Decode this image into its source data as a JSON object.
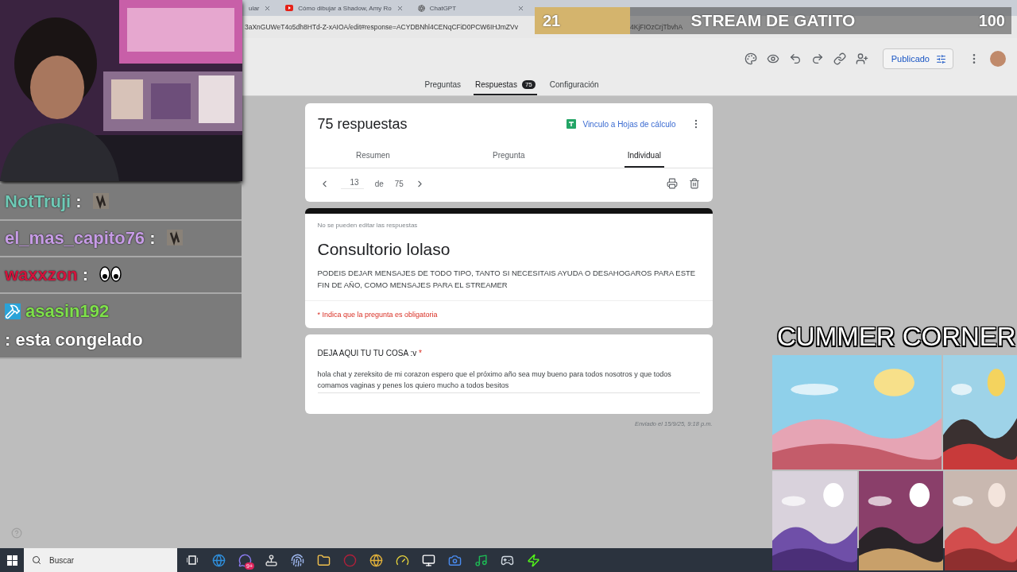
{
  "browser": {
    "tabs": [
      {
        "title": "ular",
        "kind": "plain"
      },
      {
        "title": "Cómo dibujar a Shadow, Amy Ro",
        "kind": "video"
      },
      {
        "title": "ChatGPT",
        "kind": "chat"
      }
    ],
    "address": [
      "3aXnGUWeT4o5dh8HTd-Z-xAIOA/edit#response=ACYDBNhl4CENqCFiD0PCW6IHJmZVv",
      "4KjFIOzCrjTbvhA"
    ]
  },
  "forms_header": {
    "tabs": [
      {
        "label": "Preguntas",
        "selected": false
      },
      {
        "label": "Respuestas",
        "selected": true,
        "badge": "75"
      },
      {
        "label": "Configuración",
        "selected": false
      }
    ],
    "publish_button": "Publicado"
  },
  "summary": {
    "title": "75 respuestas",
    "sheets_link": "Vinculo a Hojas de cálculo",
    "tabs": [
      {
        "label": "Resumen",
        "selected": false
      },
      {
        "label": "Pregunta",
        "selected": false
      },
      {
        "label": "Individual",
        "selected": true
      }
    ],
    "pager": {
      "current": "13",
      "of": "de",
      "total": "75"
    }
  },
  "form": {
    "notice": "No se pueden editar las respuestas",
    "title": "Consultorio lolaso",
    "description": "PODEIS DEJAR MENSAJES DE TODO TIPO, TANTO SI NECESITAIS AYUDA O DESAHOGAROS PARA ESTE FIN DE AÑO, COMO MENSAJES PARA EL STREAMER",
    "required_note": "* Indica que la pregunta es obligatoria"
  },
  "questions": [
    {
      "label": "DEJA AQUI TU TU COSA :v",
      "required_mark": "*",
      "answer": "hola chat y zereksito de mi corazon espero que el próximo año sea muy bueno para todos nosotros y que todos comamos vaginas y penes los quiero mucho a todos besitos"
    }
  ],
  "submitted": "Enviado el 15/9/25, 9:18 p.m.",
  "chat": [
    {
      "user": "NotTruji",
      "color": "#6fcab6",
      "separator": ":",
      "kind": "image-emote",
      "moderator": false
    },
    {
      "user": "el_mas_capito76",
      "color": "#c79ce6",
      "separator": ":",
      "kind": "image-emote",
      "moderator": false
    },
    {
      "user": "waxxzon",
      "color": "#d3133c",
      "separator": ":",
      "kind": "eyes-emote",
      "moderator": false
    },
    {
      "user": "asasin192",
      "color": "#7fe04b",
      "separator": ":",
      "kind": "text",
      "message": "esta congelado",
      "moderator": true
    }
  ],
  "stream_bar": {
    "count": "21",
    "title": "STREAM DE GATITO",
    "goal": "100",
    "level": 0.2
  },
  "corner": {
    "title": "CUMMER CORNER"
  },
  "taskbar": {
    "search_placeholder": "Buscar",
    "chat_badge": "9+"
  }
}
